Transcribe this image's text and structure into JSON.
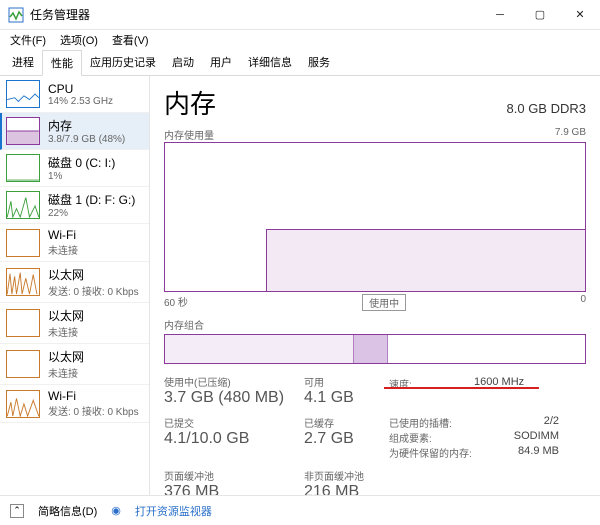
{
  "window": {
    "title": "任务管理器"
  },
  "menu": {
    "file": "文件(F)",
    "options": "选项(O)",
    "view": "查看(V)"
  },
  "tabs": [
    "进程",
    "性能",
    "应用历史记录",
    "启动",
    "用户",
    "详细信息",
    "服务"
  ],
  "active_tab_index": 1,
  "sidebar": {
    "items": [
      {
        "title": "CPU",
        "sub": "14% 2.53 GHz",
        "color": "#1a73cc"
      },
      {
        "title": "内存",
        "sub": "3.8/7.9 GB (48%)",
        "color": "#8b3a9c"
      },
      {
        "title": "磁盘 0 (C: I:)",
        "sub": "1%",
        "color": "#3b9f3b"
      },
      {
        "title": "磁盘 1 (D: F: G:)",
        "sub": "22%",
        "color": "#3b9f3b"
      },
      {
        "title": "Wi-Fi",
        "sub": "未连接",
        "color": "#c97a2b"
      },
      {
        "title": "以太网",
        "sub": "发送: 0 接收: 0 Kbps",
        "color": "#c97a2b"
      },
      {
        "title": "以太网",
        "sub": "未连接",
        "color": "#c97a2b"
      },
      {
        "title": "以太网",
        "sub": "未连接",
        "color": "#c97a2b"
      },
      {
        "title": "Wi-Fi",
        "sub": "发送: 0 接收: 0 Kbps",
        "color": "#c97a2b"
      }
    ],
    "active_index": 1
  },
  "main": {
    "title": "内存",
    "spec": "8.0 GB DDR3",
    "chart": {
      "label": "内存使用量",
      "max": "7.9 GB",
      "xleft": "60 秒",
      "xright": "0",
      "in_use": "使用中"
    },
    "comp_label": "内存组合",
    "stats": {
      "used_label": "使用中(已压缩)",
      "used_val": "3.7 GB (480 MB)",
      "avail_label": "可用",
      "avail_val": "4.1 GB",
      "speed_label": "速度:",
      "speed_val": "1600 MHz",
      "slots_label": "已使用的插槽:",
      "slots_val": "2/2",
      "committed_label": "已提交",
      "committed_val": "4.1/10.0 GB",
      "cached_label": "已缓存",
      "cached_val": "2.7 GB",
      "form_label": "组成要素:",
      "form_val": "SODIMM",
      "hw_label": "为硬件保留的内存:",
      "hw_val": "84.9 MB",
      "paged_label": "页面缓冲池",
      "paged_val": "376 MB",
      "nonpaged_label": "非页面缓冲池",
      "nonpaged_val": "216 MB"
    }
  },
  "footer": {
    "brief": "简略信息(D)",
    "resmon": "打开资源监视器"
  },
  "chart_data": {
    "type": "area",
    "title": "内存使用量",
    "xlabel": "秒",
    "ylabel": "GB",
    "xlim": [
      60,
      0
    ],
    "ylim": [
      0,
      7.9
    ],
    "series": [
      {
        "name": "内存使用中",
        "x": [
          60,
          55,
          50,
          48,
          46,
          45,
          44,
          40,
          35,
          30,
          25,
          20,
          15,
          10,
          5,
          0
        ],
        "values": [
          0,
          0,
          0,
          0,
          0,
          0,
          3.3,
          3.3,
          3.3,
          3.3,
          3.3,
          3.3,
          3.3,
          3.3,
          3.3,
          3.3
        ]
      }
    ]
  }
}
